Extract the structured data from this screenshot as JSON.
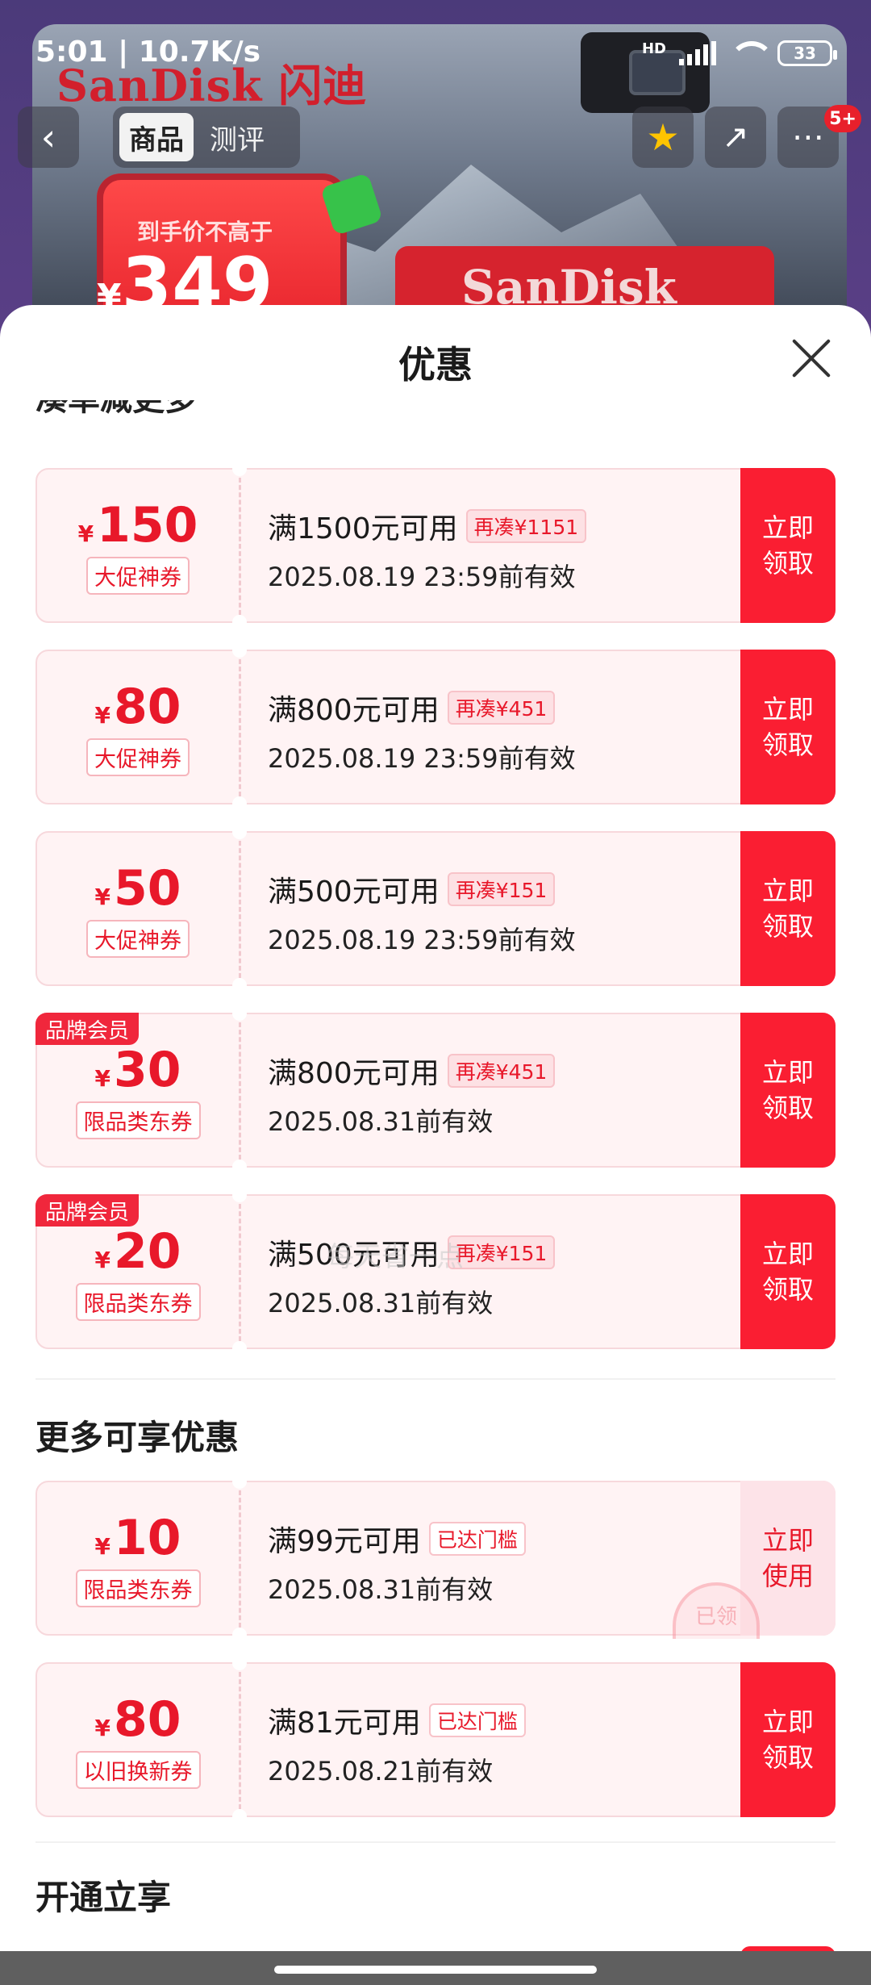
{
  "status_bar": {
    "time": "5:01 | 10.7K/s",
    "network": "HD",
    "battery": "33"
  },
  "background": {
    "brand": "SanDisk 闪迪",
    "price_label": "到手价不高于",
    "price_symbol": "¥",
    "price_value": "349",
    "card_brand": "SanDisk"
  },
  "nav": {
    "back_icon": "back-icon",
    "tabs": [
      {
        "label": "商品",
        "active": true
      },
      {
        "label": "测评",
        "active": false
      }
    ],
    "actions": [
      "star-icon",
      "share-icon",
      "more-icon"
    ],
    "more_badge": "5+"
  },
  "sheet": {
    "title": "优惠",
    "close_icon": "close-icon",
    "cut_heading": "凑单减更多",
    "sections": [
      {
        "title": "更多可享优惠"
      },
      {
        "title": "开通立享"
      }
    ],
    "coupons": [
      {
        "currency": "¥",
        "amount": "150",
        "tag": "大促神券",
        "member": "",
        "condition": "满1500元可用",
        "chip": "再凑¥1151",
        "validity": "2025.08.19 23:59前有效",
        "button": "立即\n领取",
        "used": false
      },
      {
        "currency": "¥",
        "amount": "80",
        "tag": "大促神券",
        "member": "",
        "condition": "满800元可用",
        "chip": "再凑¥451",
        "validity": "2025.08.19 23:59前有效",
        "button": "立即\n领取",
        "used": false
      },
      {
        "currency": "¥",
        "amount": "50",
        "tag": "大促神券",
        "member": "",
        "condition": "满500元可用",
        "chip": "再凑¥151",
        "validity": "2025.08.19 23:59前有效",
        "button": "立即\n领取",
        "used": false
      },
      {
        "currency": "¥",
        "amount": "30",
        "tag": "限品类东券",
        "member": "品牌会员",
        "condition": "满800元可用",
        "chip": "再凑¥451",
        "validity": "2025.08.31前有效",
        "button": "立即\n领取",
        "used": false
      },
      {
        "currency": "¥",
        "amount": "20",
        "tag": "限品类东券",
        "member": "品牌会员",
        "condition": "满500元可用",
        "chip": "再凑¥151",
        "validity": "2025.08.31前有效",
        "button": "立即\n领取",
        "used": false
      },
      {
        "currency": "¥",
        "amount": "10",
        "tag": "限品类东券",
        "member": "",
        "condition": "满99元可用",
        "chip": "已达门槛",
        "validity": "2025.08.31前有效",
        "button": "立即\n使用",
        "used": true,
        "stamp": "已领"
      },
      {
        "currency": "¥",
        "amount": "80",
        "tag": "以旧换新券",
        "member": "",
        "condition": "满81元可用",
        "chip": "已达门槛",
        "validity": "2025.08.21前有效",
        "button": "立即\n领取",
        "used": false
      }
    ],
    "watermark": "每天省一点"
  },
  "colors": {
    "accent": "#fa1e32",
    "coupon_bg": "#fff3f4",
    "header_purple": "#4b3a7a"
  }
}
